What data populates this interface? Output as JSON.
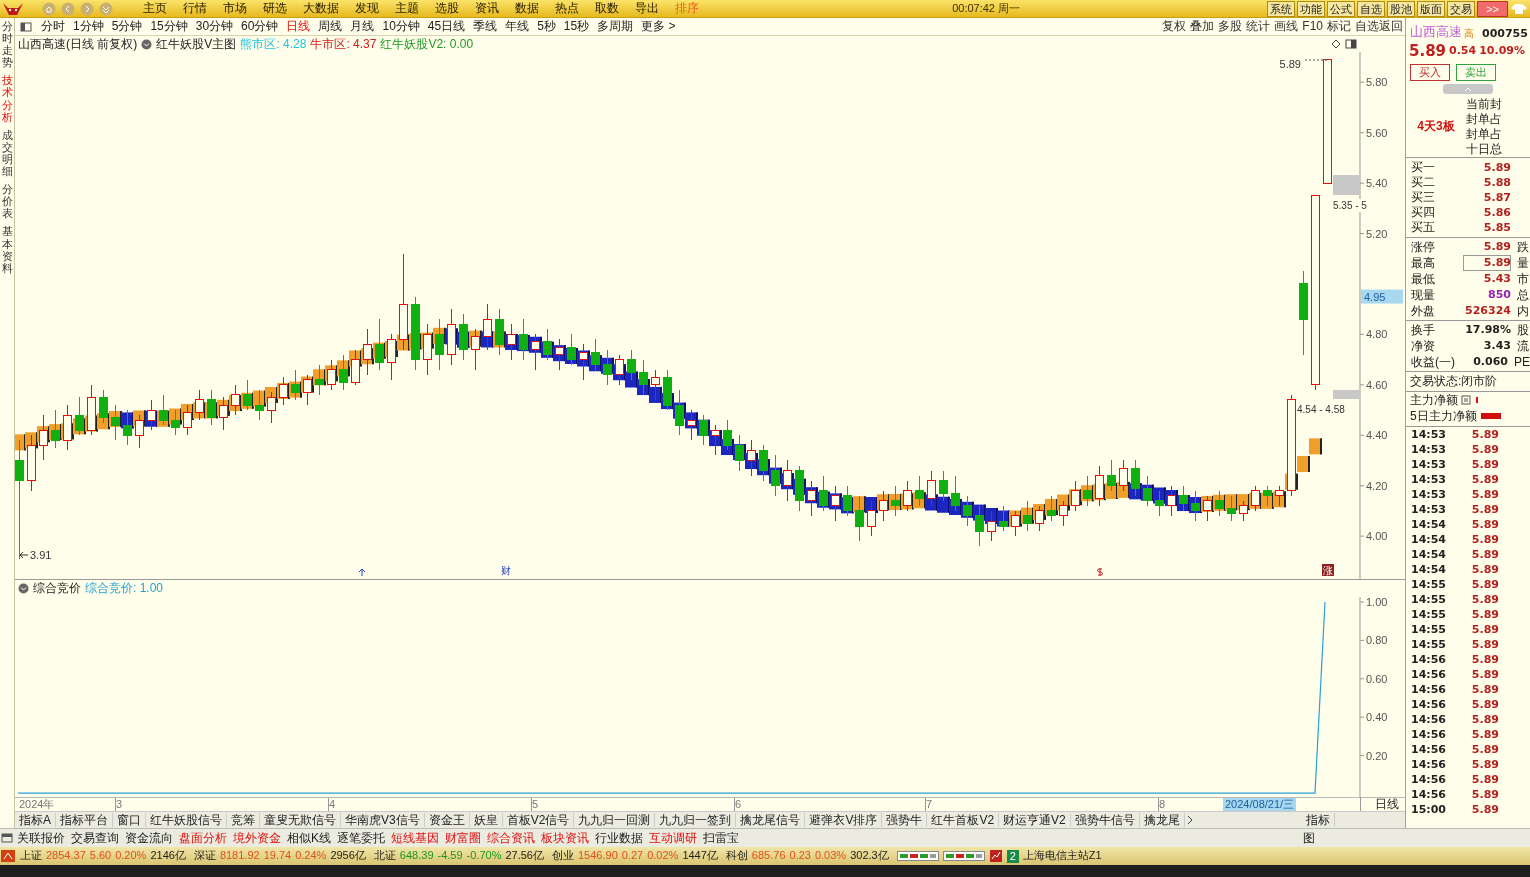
{
  "title_bar": {
    "menu": [
      {
        "label": "主页",
        "selected": false
      },
      {
        "label": "行情",
        "selected": false
      },
      {
        "label": "市场",
        "selected": false
      },
      {
        "label": "研选",
        "selected": false
      },
      {
        "label": "大数据",
        "selected": false
      },
      {
        "label": "发现",
        "selected": false
      },
      {
        "label": "主题",
        "selected": false
      },
      {
        "label": "选股",
        "selected": false
      },
      {
        "label": "资讯",
        "selected": false
      },
      {
        "label": "数据",
        "selected": false
      },
      {
        "label": "热点",
        "selected": false
      },
      {
        "label": "取数",
        "selected": false
      },
      {
        "label": "导出",
        "selected": false
      },
      {
        "label": "排序",
        "selected": true
      }
    ],
    "clock": "00:07:42 周一",
    "buttons": [
      "系统",
      "功能",
      "公式",
      "自选",
      "股池",
      "版面",
      "交易"
    ],
    "more_button": ">>"
  },
  "side_tabs": [
    {
      "label": "分时走势",
      "selected": false
    },
    {
      "label": "技术分析",
      "selected": true
    },
    {
      "label": "成交明细",
      "selected": false
    },
    {
      "label": "分价表",
      "selected": false
    },
    {
      "label": "基本资料",
      "selected": false
    }
  ],
  "period_tabs": [
    {
      "label": "分时",
      "selected": false
    },
    {
      "label": "1分钟",
      "selected": false
    },
    {
      "label": "5分钟",
      "selected": false
    },
    {
      "label": "15分钟",
      "selected": false
    },
    {
      "label": "30分钟",
      "selected": false
    },
    {
      "label": "60分钟",
      "selected": false
    },
    {
      "label": "日线",
      "selected": true
    },
    {
      "label": "周线",
      "selected": false
    },
    {
      "label": "月线",
      "selected": false
    },
    {
      "label": "10分钟",
      "selected": false
    },
    {
      "label": "45日线",
      "selected": false
    },
    {
      "label": "季线",
      "selected": false
    },
    {
      "label": "年线",
      "selected": false
    },
    {
      "label": "5秒",
      "selected": false
    },
    {
      "label": "15秒",
      "selected": false
    },
    {
      "label": "多周期",
      "selected": false
    },
    {
      "label": "更多 >",
      "selected": false
    }
  ],
  "toolbar": [
    "复权",
    "叠加",
    "多股",
    "统计",
    "画线",
    "F10",
    "标记",
    "自选返回"
  ],
  "main_chart": {
    "title": "山西高速(日线 前复权)",
    "indicator": "红牛妖股V主图",
    "legend": [
      {
        "label": "熊市区: 4.28",
        "color": "#22c4e0"
      },
      {
        "label": "牛市区: 4.37",
        "color": "#d42020"
      },
      {
        "label": "红牛妖股V2: 0.00",
        "color": "#209a20"
      }
    ],
    "chart_data": {
      "type": "candlestick",
      "ylim": [
        3.83,
        5.92
      ],
      "yticks": [
        {
          "value": 5.8,
          "label": "5.80"
        },
        {
          "value": 5.6,
          "label": "5.60"
        },
        {
          "value": 5.4,
          "label": "5.40"
        },
        {
          "value": 5.2,
          "label": "5.20"
        },
        {
          "value": 4.8,
          "label": "4.80"
        },
        {
          "value": 4.6,
          "label": "4.60"
        },
        {
          "value": 4.4,
          "label": "4.40"
        },
        {
          "value": 4.2,
          "label": "4.20"
        },
        {
          "value": 4.0,
          "label": "4.00"
        }
      ],
      "ohlc": [
        [
          4.3,
          4.38,
          3.91,
          4.22
        ],
        [
          4.22,
          4.4,
          4.18,
          4.36
        ],
        [
          4.36,
          4.48,
          4.3,
          4.42
        ],
        [
          4.42,
          4.5,
          4.35,
          4.38
        ],
        [
          4.38,
          4.52,
          4.34,
          4.48
        ],
        [
          4.48,
          4.55,
          4.4,
          4.42
        ],
        [
          4.42,
          4.6,
          4.4,
          4.55
        ],
        [
          4.55,
          4.58,
          4.45,
          4.47
        ],
        [
          4.47,
          4.52,
          4.38,
          4.44
        ],
        [
          4.44,
          4.5,
          4.36,
          4.4
        ],
        [
          4.4,
          4.48,
          4.35,
          4.46
        ],
        [
          4.46,
          4.54,
          4.42,
          4.5
        ],
        [
          4.5,
          4.56,
          4.44,
          4.46
        ],
        [
          4.46,
          4.5,
          4.4,
          4.43
        ],
        [
          4.43,
          4.52,
          4.4,
          4.49
        ],
        [
          4.49,
          4.58,
          4.46,
          4.54
        ],
        [
          4.54,
          4.58,
          4.44,
          4.47
        ],
        [
          4.47,
          4.55,
          4.42,
          4.52
        ],
        [
          4.52,
          4.6,
          4.48,
          4.56
        ],
        [
          4.56,
          4.62,
          4.5,
          4.52
        ],
        [
          4.52,
          4.58,
          4.46,
          4.5
        ],
        [
          4.5,
          4.57,
          4.45,
          4.55
        ],
        [
          4.55,
          4.63,
          4.52,
          4.6
        ],
        [
          4.6,
          4.66,
          4.54,
          4.57
        ],
        [
          4.57,
          4.64,
          4.52,
          4.62
        ],
        [
          4.62,
          4.68,
          4.56,
          4.6
        ],
        [
          4.6,
          4.7,
          4.58,
          4.66
        ],
        [
          4.66,
          4.72,
          4.58,
          4.61
        ],
        [
          4.61,
          4.74,
          4.6,
          4.7
        ],
        [
          4.7,
          4.82,
          4.64,
          4.76
        ],
        [
          4.76,
          4.86,
          4.66,
          4.69
        ],
        [
          4.69,
          4.8,
          4.62,
          4.78
        ],
        [
          4.78,
          5.12,
          4.74,
          4.92
        ],
        [
          4.92,
          4.95,
          4.66,
          4.7
        ],
        [
          4.7,
          4.84,
          4.64,
          4.8
        ],
        [
          4.8,
          4.86,
          4.66,
          4.72
        ],
        [
          4.72,
          4.9,
          4.68,
          4.84
        ],
        [
          4.84,
          4.88,
          4.7,
          4.74
        ],
        [
          4.74,
          4.82,
          4.66,
          4.79
        ],
        [
          4.79,
          4.92,
          4.74,
          4.86
        ],
        [
          4.86,
          4.9,
          4.72,
          4.76
        ],
        [
          4.76,
          4.84,
          4.7,
          4.8
        ],
        [
          4.8,
          4.86,
          4.7,
          4.74
        ],
        [
          4.74,
          4.8,
          4.66,
          4.77
        ],
        [
          4.77,
          4.82,
          4.7,
          4.72
        ],
        [
          4.72,
          4.78,
          4.66,
          4.75
        ],
        [
          4.75,
          4.8,
          4.68,
          4.7
        ],
        [
          4.7,
          4.76,
          4.62,
          4.73
        ],
        [
          4.73,
          4.78,
          4.66,
          4.68
        ],
        [
          4.68,
          4.74,
          4.6,
          4.64
        ],
        [
          4.64,
          4.72,
          4.6,
          4.7
        ],
        [
          4.7,
          4.74,
          4.62,
          4.65
        ],
        [
          4.65,
          4.7,
          4.56,
          4.6
        ],
        [
          4.6,
          4.66,
          4.54,
          4.63
        ],
        [
          4.63,
          4.66,
          4.5,
          4.52
        ],
        [
          4.52,
          4.58,
          4.4,
          4.44
        ],
        [
          4.44,
          4.5,
          4.38,
          4.46
        ],
        [
          4.46,
          4.48,
          4.36,
          4.4
        ],
        [
          4.4,
          4.44,
          4.32,
          4.42
        ],
        [
          4.42,
          4.46,
          4.34,
          4.36
        ],
        [
          4.36,
          4.4,
          4.26,
          4.3
        ],
        [
          4.3,
          4.38,
          4.24,
          4.34
        ],
        [
          4.34,
          4.36,
          4.22,
          4.26
        ],
        [
          4.26,
          4.32,
          4.16,
          4.2
        ],
        [
          4.2,
          4.3,
          4.14,
          4.26
        ],
        [
          4.26,
          4.28,
          4.1,
          4.14
        ],
        [
          4.14,
          4.22,
          4.08,
          4.18
        ],
        [
          4.18,
          4.24,
          4.1,
          4.12
        ],
        [
          4.12,
          4.2,
          4.06,
          4.16
        ],
        [
          4.16,
          4.2,
          4.08,
          4.1
        ],
        [
          4.1,
          4.16,
          3.98,
          4.04
        ],
        [
          4.04,
          4.14,
          4.0,
          4.1
        ],
        [
          4.1,
          4.18,
          4.06,
          4.14
        ],
        [
          4.14,
          4.2,
          4.08,
          4.12
        ],
        [
          4.12,
          4.22,
          4.1,
          4.18
        ],
        [
          4.18,
          4.24,
          4.12,
          4.15
        ],
        [
          4.15,
          4.26,
          4.12,
          4.22
        ],
        [
          4.22,
          4.26,
          4.14,
          4.17
        ],
        [
          4.17,
          4.24,
          4.1,
          4.12
        ],
        [
          4.12,
          4.16,
          4.04,
          4.08
        ],
        [
          4.08,
          4.12,
          3.96,
          4.02
        ],
        [
          4.02,
          4.1,
          3.98,
          4.06
        ],
        [
          4.06,
          4.12,
          4.02,
          4.04
        ],
        [
          4.04,
          4.1,
          4.0,
          4.08
        ],
        [
          4.08,
          4.14,
          4.02,
          4.05
        ],
        [
          4.05,
          4.12,
          4.02,
          4.1
        ],
        [
          4.1,
          4.16,
          4.06,
          4.08
        ],
        [
          4.08,
          4.14,
          4.04,
          4.12
        ],
        [
          4.12,
          4.22,
          4.1,
          4.18
        ],
        [
          4.18,
          4.24,
          4.12,
          4.15
        ],
        [
          4.15,
          4.28,
          4.12,
          4.24
        ],
        [
          4.24,
          4.3,
          4.18,
          4.2
        ],
        [
          4.2,
          4.3,
          4.18,
          4.27
        ],
        [
          4.27,
          4.3,
          4.16,
          4.19
        ],
        [
          4.19,
          4.24,
          4.12,
          4.14
        ],
        [
          4.14,
          4.18,
          4.08,
          4.12
        ],
        [
          4.12,
          4.2,
          4.08,
          4.16
        ],
        [
          4.16,
          4.2,
          4.1,
          4.13
        ],
        [
          4.13,
          4.18,
          4.06,
          4.1
        ],
        [
          4.1,
          4.16,
          4.06,
          4.14
        ],
        [
          4.14,
          4.18,
          4.08,
          4.11
        ],
        [
          4.11,
          4.16,
          4.06,
          4.09
        ],
        [
          4.09,
          4.14,
          4.06,
          4.12
        ],
        [
          4.12,
          4.2,
          4.1,
          4.18
        ],
        [
          4.18,
          4.2,
          4.12,
          4.16
        ],
        [
          4.16,
          4.2,
          4.12,
          4.18
        ],
        [
          4.18,
          4.56,
          4.16,
          4.54
        ],
        [
          5.0,
          5.05,
          4.72,
          4.86
        ],
        [
          4.6,
          5.35,
          4.58,
          5.35
        ],
        [
          5.4,
          5.89,
          5.4,
          5.89
        ]
      ]
    },
    "current_price": "4.95",
    "high_label": "5.89",
    "low_label": "3.91",
    "zone_labels": [
      "5.35 - 5",
      "4.54 - 4.58"
    ],
    "event_marks": [
      "财",
      "涨"
    ]
  },
  "sub_chart": {
    "title": "综合竞价",
    "legend": "综合竞价: 1.00",
    "axis": [
      "1.00",
      "0.80",
      "0.60",
      "0.40",
      "0.20"
    ]
  },
  "date_axis": {
    "labels": [
      "2024年",
      "3",
      "4",
      "5",
      "6",
      "7",
      "8"
    ],
    "cursor_date": "2024/08/21/三",
    "period": "日线"
  },
  "indicator_tabs": [
    "指标A",
    "指标平台",
    "窗口",
    "红牛妖股信号",
    "竞筹",
    "童叟无欺信号",
    "华南虎V3信号",
    "资金王",
    "妖皇",
    "首板V2信号",
    "九九归一回测",
    "九九归一签到",
    "擒龙尾信号",
    "避弹衣V排序",
    "强势牛",
    "红牛首板V2",
    "财运亨通V2",
    "强势牛信号",
    "擒龙尾"
  ],
  "indicator_button": "指标",
  "bottom_tabs": [
    {
      "label": "关联报价",
      "highlighted": false
    },
    {
      "label": "交易查询",
      "highlighted": false
    },
    {
      "label": "资金流向",
      "highlighted": false
    },
    {
      "label": "盘面分析",
      "highlighted": true
    },
    {
      "label": "境外资金",
      "highlighted": true
    },
    {
      "label": "相似K线",
      "highlighted": false
    },
    {
      "label": "逐笔委托",
      "highlighted": false
    },
    {
      "label": "短线基因",
      "highlighted": true
    },
    {
      "label": "财富圈",
      "highlighted": true
    },
    {
      "label": "综合资讯",
      "highlighted": true
    },
    {
      "label": "板块资讯",
      "highlighted": true
    },
    {
      "label": "行业数据",
      "highlighted": false
    },
    {
      "label": "互动调研",
      "highlighted": true
    },
    {
      "label": "扫雷宝",
      "highlighted": false
    }
  ],
  "bottom_right": "图",
  "status_bar": {
    "indices": [
      {
        "name": "上证",
        "value": "2854.37",
        "change": "5.60",
        "percent": "0.20%",
        "amount": "2146亿",
        "color": "#e0501a"
      },
      {
        "name": "深证",
        "value": "8181.92",
        "change": "19.74",
        "percent": "0.24%",
        "amount": "2956亿",
        "color": "#e0501a"
      },
      {
        "name": "北证",
        "value": "648.39",
        "change": "-4.59",
        "percent": "-0.70%",
        "amount": "27.56亿",
        "color": "#1a9a1a"
      },
      {
        "name": "创业",
        "value": "1546.90",
        "change": "0.27",
        "percent": "0.02%",
        "amount": "1447亿",
        "color": "#e0501a"
      },
      {
        "name": "科创",
        "value": "685.76",
        "change": "0.23",
        "percent": "0.03%",
        "amount": "302.3亿",
        "color": "#e0501a"
      }
    ],
    "badge": "2",
    "server": "上海电信主站Z1"
  },
  "quote_panel": {
    "name": "山西高速",
    "tag": "高",
    "code": "000755",
    "price": "5.89",
    "change": "0.54",
    "percent": "10.09%",
    "buttons": [
      {
        "label": "买入",
        "kind": "buy"
      },
      {
        "label": "卖出",
        "kind": "sell"
      }
    ],
    "board_streak": "4天3板",
    "seal_labels": [
      "当前封",
      "封单占",
      "封单占",
      "十日总"
    ],
    "order_book": [
      {
        "label": "买一",
        "price": "5.89"
      },
      {
        "label": "买二",
        "price": "5.88"
      },
      {
        "label": "买三",
        "price": "5.87"
      },
      {
        "label": "买四",
        "price": "5.86"
      },
      {
        "label": "买五",
        "price": "5.85"
      }
    ],
    "stats": [
      {
        "label": "涨停",
        "value": "5.89",
        "side": "跌",
        "color": "#b42020",
        "highlighted": false
      },
      {
        "label": "最高",
        "value": "5.89",
        "side": "量",
        "color": "#b42020",
        "highlighted": true
      },
      {
        "label": "最低",
        "value": "5.43",
        "side": "市",
        "color": "#b42020",
        "highlighted": false
      },
      {
        "label": "现量",
        "value": "850",
        "side": "总",
        "color": "#9a20b0",
        "highlighted": false
      },
      {
        "label": "外盘",
        "value": "526324",
        "side": "内",
        "color": "#b42020",
        "highlighted": false
      }
    ],
    "fundamentals": [
      {
        "label": "换手",
        "value": "17.98%",
        "side": "股"
      },
      {
        "label": "净资",
        "value": "3.43",
        "side": "流"
      },
      {
        "label": "收益(一)",
        "value": "0.060",
        "side": "PE"
      }
    ],
    "trade_status": "交易状态:闭市阶",
    "flows": [
      "主力净额",
      "5日主力净额"
    ],
    "ticks": [
      {
        "time": "14:53",
        "price": "5.89"
      },
      {
        "time": "14:53",
        "price": "5.89"
      },
      {
        "time": "14:53",
        "price": "5.89"
      },
      {
        "time": "14:53",
        "price": "5.89"
      },
      {
        "time": "14:53",
        "price": "5.89"
      },
      {
        "time": "14:53",
        "price": "5.89"
      },
      {
        "time": "14:54",
        "price": "5.89"
      },
      {
        "time": "14:54",
        "price": "5.89"
      },
      {
        "time": "14:54",
        "price": "5.89"
      },
      {
        "time": "14:54",
        "price": "5.89"
      },
      {
        "time": "14:55",
        "price": "5.89"
      },
      {
        "time": "14:55",
        "price": "5.89"
      },
      {
        "time": "14:55",
        "price": "5.89"
      },
      {
        "time": "14:55",
        "price": "5.89"
      },
      {
        "time": "14:55",
        "price": "5.89"
      },
      {
        "time": "14:56",
        "price": "5.89"
      },
      {
        "time": "14:56",
        "price": "5.89"
      },
      {
        "time": "14:56",
        "price": "5.89"
      },
      {
        "time": "14:56",
        "price": "5.89"
      },
      {
        "time": "14:56",
        "price": "5.89"
      },
      {
        "time": "14:56",
        "price": "5.89"
      },
      {
        "time": "14:56",
        "price": "5.89"
      },
      {
        "time": "14:56",
        "price": "5.89"
      },
      {
        "time": "14:56",
        "price": "5.89"
      },
      {
        "time": "14:56",
        "price": "5.89"
      },
      {
        "time": "15:00",
        "price": "5.89"
      }
    ]
  }
}
